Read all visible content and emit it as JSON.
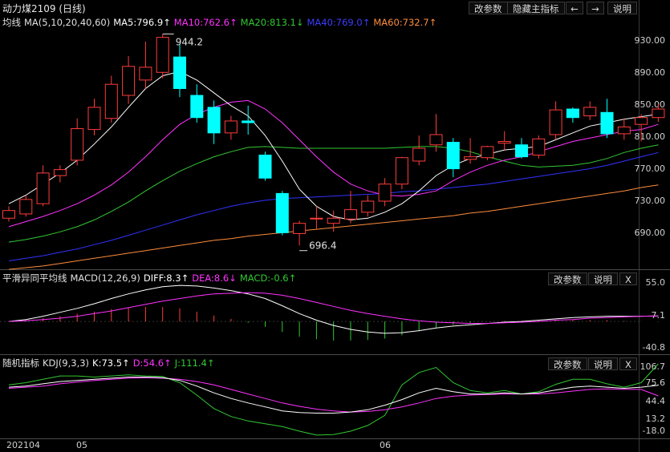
{
  "window": {
    "title": "动力煤2109 (日线)"
  },
  "toolbar": {
    "params_label": "改参数",
    "hide_indicator_label": "隐藏主指标",
    "left_arrow": "←",
    "right_arrow": "→",
    "help_label": "说明"
  },
  "main_pane": {
    "ma_label": "均线",
    "ma_params": "MA(5,10,20,40,60)",
    "ma5": "MA5:796.9↑",
    "ma10": "MA10:762.6↑",
    "ma20": "MA20:813.1↓",
    "ma40": "MA40:769.0↑",
    "ma60": "MA60:732.7↑",
    "high_annotation": "944.2",
    "low_annotation": "696.4",
    "axis": [
      "930.00",
      "890.00",
      "850.00",
      "810.00",
      "770.00",
      "730.00",
      "690.00"
    ]
  },
  "macd_pane": {
    "label": "平滑异同平均线",
    "params": "MACD(12,26,9)",
    "diff": "DIFF:8.3↑",
    "dea": "DEA:8.6↓",
    "macd": "MACD:-0.6↑",
    "params_btn": "改参数",
    "help_btn": "说明",
    "close_btn": "X",
    "axis": [
      "55.0",
      "7.1",
      "-40.8"
    ]
  },
  "kdj_pane": {
    "label": "随机指标",
    "params": "KDJ(9,3,3)",
    "k": "K:73.5↑",
    "d": "D:54.6↑",
    "j": "J:111.4↑",
    "params_btn": "改参数",
    "help_btn": "说明",
    "close_btn": "X",
    "axis": [
      "106.7",
      "75.6",
      "44.4",
      "13.2",
      "-18.0"
    ]
  },
  "date_axis": {
    "labels": [
      "202104",
      "05",
      "06"
    ]
  },
  "colors": {
    "up": "#ff3c3c",
    "down": "#00ffff",
    "ma5": "#ffffff",
    "ma10": "#ff32ff",
    "ma20": "#32c832",
    "ma40": "#3232ff",
    "ma60": "#ff8c3c",
    "dea": "#ff32ff",
    "macd": "#32c832",
    "kdj_j": "#32c832"
  },
  "chart_data": {
    "type": "candlestick",
    "title": "动力煤2109 (日线)",
    "y_range": [
      670,
      950
    ],
    "candles": [
      {
        "o": 728,
        "h": 742,
        "l": 724,
        "c": 737
      },
      {
        "o": 733,
        "h": 755,
        "l": 730,
        "c": 750
      },
      {
        "o": 745,
        "h": 790,
        "l": 742,
        "c": 781
      },
      {
        "o": 778,
        "h": 790,
        "l": 770,
        "c": 785
      },
      {
        "o": 796,
        "h": 845,
        "l": 790,
        "c": 833
      },
      {
        "o": 832,
        "h": 868,
        "l": 825,
        "c": 858
      },
      {
        "o": 845,
        "h": 895,
        "l": 840,
        "c": 885
      },
      {
        "o": 872,
        "h": 918,
        "l": 862,
        "c": 906
      },
      {
        "o": 890,
        "h": 935,
        "l": 880,
        "c": 905
      },
      {
        "o": 899,
        "h": 944,
        "l": 892,
        "c": 940
      },
      {
        "o": 917,
        "h": 932,
        "l": 870,
        "c": 880
      },
      {
        "o": 872,
        "h": 885,
        "l": 840,
        "c": 846
      },
      {
        "o": 858,
        "h": 866,
        "l": 815,
        "c": 828
      },
      {
        "o": 828,
        "h": 848,
        "l": 820,
        "c": 842
      },
      {
        "o": 842,
        "h": 860,
        "l": 826,
        "c": 840
      },
      {
        "o": 802,
        "h": 806,
        "l": 772,
        "c": 775
      },
      {
        "o": 757,
        "h": 760,
        "l": 708,
        "c": 711
      },
      {
        "o": 710,
        "h": 725,
        "l": 696,
        "c": 722
      },
      {
        "o": 728,
        "h": 742,
        "l": 715,
        "c": 728
      },
      {
        "o": 722,
        "h": 737,
        "l": 712,
        "c": 728
      },
      {
        "o": 727,
        "h": 760,
        "l": 722,
        "c": 738
      },
      {
        "o": 735,
        "h": 755,
        "l": 730,
        "c": 748
      },
      {
        "o": 748,
        "h": 775,
        "l": 742,
        "c": 768
      },
      {
        "o": 768,
        "h": 800,
        "l": 762,
        "c": 799
      },
      {
        "o": 795,
        "h": 825,
        "l": 790,
        "c": 810
      },
      {
        "o": 814,
        "h": 850,
        "l": 806,
        "c": 826
      },
      {
        "o": 817,
        "h": 822,
        "l": 776,
        "c": 786
      },
      {
        "o": 797,
        "h": 822,
        "l": 792,
        "c": 800
      },
      {
        "o": 799,
        "h": 813,
        "l": 796,
        "c": 812
      },
      {
        "o": 816,
        "h": 830,
        "l": 808,
        "c": 818
      },
      {
        "o": 814,
        "h": 822,
        "l": 798,
        "c": 800
      },
      {
        "o": 802,
        "h": 825,
        "l": 798,
        "c": 821
      },
      {
        "o": 826,
        "h": 865,
        "l": 820,
        "c": 855
      },
      {
        "o": 856,
        "h": 858,
        "l": 840,
        "c": 846
      },
      {
        "o": 848,
        "h": 865,
        "l": 843,
        "c": 858
      },
      {
        "o": 852,
        "h": 868,
        "l": 822,
        "c": 827
      },
      {
        "o": 827,
        "h": 845,
        "l": 820,
        "c": 835
      },
      {
        "o": 838,
        "h": 850,
        "l": 818,
        "c": 846
      },
      {
        "o": 846,
        "h": 862,
        "l": 841,
        "c": 856
      }
    ],
    "ma5": [
      745,
      755,
      768,
      781,
      796,
      815,
      835,
      858,
      880,
      895,
      900,
      890,
      875,
      860,
      848,
      825,
      795,
      762,
      742,
      730,
      726,
      728,
      735,
      745,
      760,
      778,
      790,
      798,
      803,
      808,
      810,
      812,
      820,
      828,
      836,
      840,
      844,
      847,
      850
    ],
    "ma10": [
      718,
      724,
      730,
      737,
      745,
      755,
      767,
      782,
      800,
      820,
      838,
      850,
      858,
      864,
      866,
      856,
      840,
      820,
      800,
      782,
      768,
      760,
      755,
      754,
      756,
      760,
      772,
      782,
      790,
      796,
      800,
      806,
      812,
      818,
      822,
      826,
      830,
      832,
      838
    ],
    "ma20": [
      700,
      703,
      707,
      712,
      718,
      726,
      736,
      747,
      760,
      772,
      783,
      792,
      800,
      806,
      811,
      812,
      811,
      810,
      810,
      810,
      810,
      810,
      810,
      811,
      812,
      812,
      810,
      806,
      800,
      795,
      790,
      788,
      789,
      790,
      793,
      798,
      805,
      810,
      814
    ],
    "ma40": [
      678,
      681,
      684,
      688,
      692,
      697,
      702,
      708,
      714,
      720,
      726,
      732,
      737,
      742,
      746,
      749,
      751,
      752,
      753,
      754,
      755,
      756,
      757,
      759,
      760,
      762,
      764,
      766,
      768,
      771,
      774,
      777,
      780,
      783,
      786,
      790,
      795,
      800,
      805
    ],
    "ma60": [
      668,
      670,
      672,
      675,
      678,
      681,
      684,
      687,
      690,
      693,
      696,
      699,
      702,
      704,
      707,
      709,
      711,
      713,
      715,
      717,
      719,
      721,
      723,
      725,
      727,
      729,
      731,
      734,
      736,
      739,
      742,
      745,
      748,
      751,
      754,
      757,
      760,
      764,
      767
    ],
    "macd": {
      "y_range": [
        -45,
        60
      ],
      "diff": [
        0,
        3,
        8,
        14,
        20,
        27,
        35,
        42,
        48,
        53,
        55,
        54,
        51,
        47,
        42,
        35,
        24,
        12,
        2,
        -6,
        -12,
        -16,
        -18,
        -17,
        -14,
        -10,
        -7,
        -5,
        -3,
        -1,
        0,
        2,
        4,
        6,
        7,
        8,
        8,
        8,
        8.3
      ],
      "dea": [
        0,
        1,
        3,
        5,
        8,
        12,
        16,
        21,
        26,
        31,
        35,
        39,
        42,
        43,
        44,
        43,
        40,
        35,
        29,
        23,
        17,
        12,
        8,
        4,
        1,
        -1,
        -2,
        -3,
        -3,
        -2,
        -1,
        0,
        2,
        3,
        5,
        6,
        7,
        8,
        8.6
      ],
      "hist": [
        0,
        2,
        5,
        8,
        12,
        15,
        19,
        21,
        22,
        22,
        20,
        15,
        9,
        4,
        -2,
        -8,
        -16,
        -23,
        -27,
        -29,
        -29,
        -28,
        -26,
        -21,
        -15,
        -9,
        -5,
        -2,
        0,
        1,
        1,
        2,
        2,
        3,
        2,
        2,
        1,
        0.5,
        -0.6
      ]
    },
    "kdj": {
      "y_range": [
        -18,
        110
      ],
      "k": [
        70,
        72,
        76,
        80,
        82,
        84,
        86,
        88,
        88,
        87,
        82,
        72,
        60,
        50,
        42,
        35,
        28,
        25,
        24,
        24,
        26,
        30,
        38,
        48,
        60,
        68,
        62,
        58,
        58,
        60,
        58,
        60,
        65,
        70,
        72,
        70,
        68,
        70,
        73.5
      ],
      "d": [
        68,
        70,
        72,
        76,
        79,
        82,
        84,
        86,
        87,
        86,
        84,
        80,
        74,
        66,
        58,
        50,
        42,
        36,
        31,
        28,
        26,
        27,
        30,
        35,
        42,
        50,
        54,
        56,
        57,
        58,
        58,
        58,
        60,
        63,
        66,
        67,
        66,
        66,
        54.6
      ],
      "j": [
        74,
        78,
        84,
        90,
        90,
        88,
        90,
        92,
        90,
        89,
        78,
        56,
        32,
        18,
        10,
        5,
        0,
        -8,
        -15,
        -14,
        -8,
        2,
        20,
        74,
        96,
        105,
        78,
        64,
        60,
        64,
        58,
        62,
        75,
        84,
        84,
        76,
        70,
        78,
        111.4
      ]
    }
  }
}
